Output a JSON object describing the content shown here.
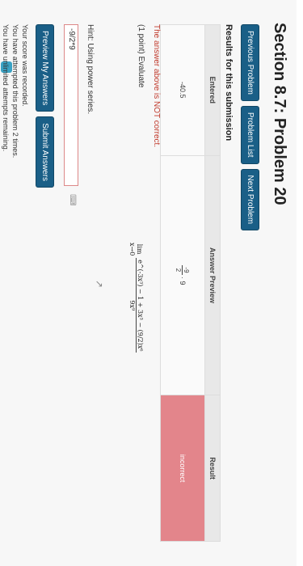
{
  "page": {
    "title": "Section 8.7: Problem 20"
  },
  "nav": {
    "previous": "Previous Problem",
    "list": "Problem List",
    "next": "Next Problem"
  },
  "results": {
    "heading": "Results for this submission",
    "headers": [
      "Entered",
      "Answer Preview",
      "Result"
    ],
    "entered": "-40.5",
    "preview_num": "-9",
    "preview_den": "2",
    "preview_tail": "· 9",
    "result": "incorrect"
  },
  "feedback": {
    "not_correct": "The answer above is NOT correct."
  },
  "problem": {
    "points": "(1 point) Evaluate",
    "limit": "lim",
    "limit_sub": "x→0",
    "limit_expr": "e^(-3x³) − 1 + 3x³ − (9/2)x⁶",
    "limit_den": "9x⁹",
    "hint": "Hint: Using power series."
  },
  "answer": {
    "value": "-9/2*9"
  },
  "actions": {
    "preview": "Preview My Answers",
    "submit": "Submit Answers"
  },
  "status": {
    "line1": "Your score was recorded.",
    "line2": "You have attempted this problem 2 times.",
    "line3": "You have unlimited attempts remaining."
  }
}
